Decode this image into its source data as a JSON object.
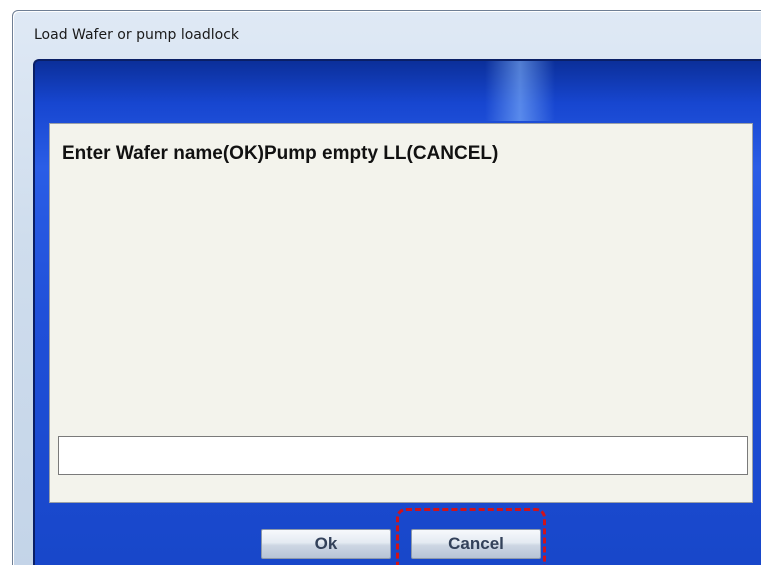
{
  "window": {
    "title": "Load Wafer or pump loadlock"
  },
  "dialog": {
    "message": "Enter Wafer name(OK)Pump empty LL(CANCEL)",
    "input_value": "",
    "ok_label": "Ok",
    "cancel_label": "Cancel"
  },
  "colors": {
    "frame_blue": "#1f4fd8",
    "panel_bg": "#f3f3ec",
    "highlight_red": "#d0121a"
  }
}
